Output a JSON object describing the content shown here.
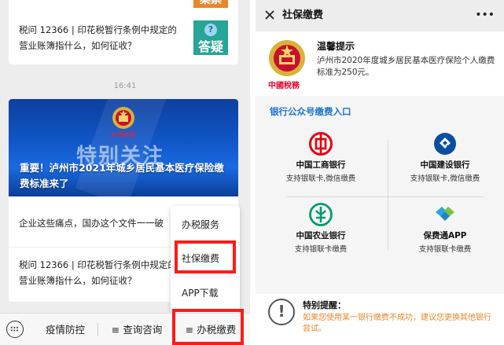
{
  "left": {
    "top_card": {
      "badge_top_text": "案票",
      "row_text": "税问 12366 | 印花税暂行条例中规定的营业账簿指什么，如何征收？",
      "thumb_text": "答疑",
      "thumb_q": "?"
    },
    "timestamp": "16:41",
    "main_card": {
      "banner_emblem_text": "中國稅務",
      "banner_bigtext": "特别关注",
      "headline": "重要！泸州市2021年城乡居民基本医疗保险缴费标准来了",
      "row1_text": "企业这些痛点，国办这个文件一一破",
      "row2_text": "税问 12366 | 印花税暂行条例中规定的营业账簿指什么，如何征收？"
    },
    "popup_menu": {
      "items": [
        "办税服务",
        "社保缴费",
        "APP下载"
      ]
    },
    "bottom_bar": {
      "items": [
        "疫情防控",
        "≡ 查询咨询",
        "≡ 办税缴费"
      ]
    }
  },
  "right": {
    "nav": {
      "title": "社保缴费"
    },
    "notice": {
      "logo_text": "中國稅務",
      "title": "温馨提示",
      "body": "泸州市2020年度城乡居民基本医疗保险个人缴费 标准为250元。"
    },
    "section_title": "银行公众号缴费入口",
    "banks": [
      {
        "name": "中国工商银行",
        "desc": "支持银联卡,微信缴费",
        "color": "#e60012",
        "icon": "icbc-logo"
      },
      {
        "name": "中国建设银行",
        "desc": "支持银联卡,微信缴费",
        "color": "#0a4ea2",
        "icon": "ccb-logo"
      },
      {
        "name": "中国农业银行",
        "desc": "支持银联卡缴费",
        "color": "#009a73",
        "icon": "abc-logo"
      },
      {
        "name": "保费通APP",
        "desc": "支持银联卡缴费",
        "color": "#2aa7e0",
        "icon": "handshake-logo"
      }
    ],
    "tip": {
      "icon": "!",
      "title": "特别提醒：",
      "body": "如果您使用某一银行缴费不成功，建议您更换其他银行 尝试。"
    }
  },
  "colors": {
    "highlight_box": "#ff1a1a",
    "link_blue": "#1a73d9",
    "tip_orange": "#e8862a"
  }
}
